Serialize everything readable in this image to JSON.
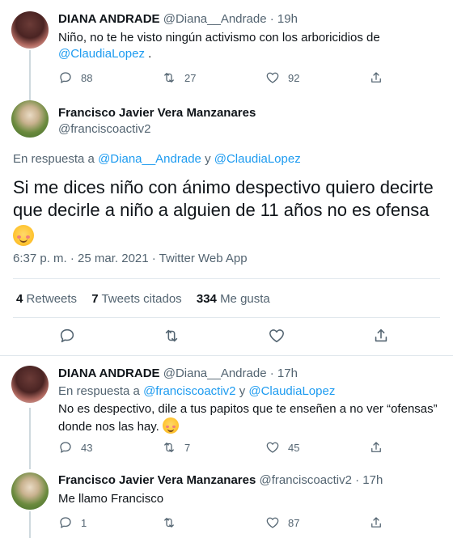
{
  "tweet1": {
    "name": "DIANA ANDRADE",
    "handle": "@Diana__Andrade",
    "time": "19h",
    "text": "Niño, no te he visto ningún activismo con los arboricidios de",
    "mention": "@ClaudiaLopez",
    "text_end": " .",
    "replies": "88",
    "retweets": "27",
    "likes": "92"
  },
  "main": {
    "name": "Francisco Javier Vera Manzanares",
    "handle": "@franciscoactiv2",
    "reply_prefix": "En respuesta a",
    "reply_to_1": "@Diana__Andrade",
    "reply_and": "y",
    "reply_to_2": "@ClaudiaLopez",
    "text_line1": "Si me dices niño con ánimo despectivo quiero decirte",
    "text_line2": "que decirle a niño a alguien de 11 años no es ofensa",
    "timestamp": "6:37 p. m. · 25 mar. 2021 · Twitter Web App",
    "stats": {
      "retweets_count": "4",
      "retweets_label": "Retweets",
      "quotes_count": "7",
      "quotes_label": "Tweets citados",
      "likes_count": "334",
      "likes_label": "Me gusta"
    }
  },
  "tweet3": {
    "name": "DIANA ANDRADE",
    "handle": "@Diana__Andrade",
    "time": "17h",
    "reply_prefix": "En respuesta a",
    "reply_to_1": "@franciscoactiv2",
    "reply_and": "y",
    "reply_to_2": "@ClaudiaLopez",
    "text_line1": "No es despectivo, dile a tus papitos que te enseñen a no ver “ofensas”",
    "text_line2": "donde nos las hay.",
    "replies": "43",
    "retweets": "7",
    "likes": "45"
  },
  "tweet4": {
    "name": "Francisco Javier Vera Manzanares",
    "handle": "@franciscoactiv2",
    "time": "17h",
    "text": "Me llamo Francisco",
    "replies": "1",
    "likes": "87"
  },
  "colors": {
    "link": "#1d9bf0",
    "muted": "#536471",
    "text": "#0f1419"
  }
}
